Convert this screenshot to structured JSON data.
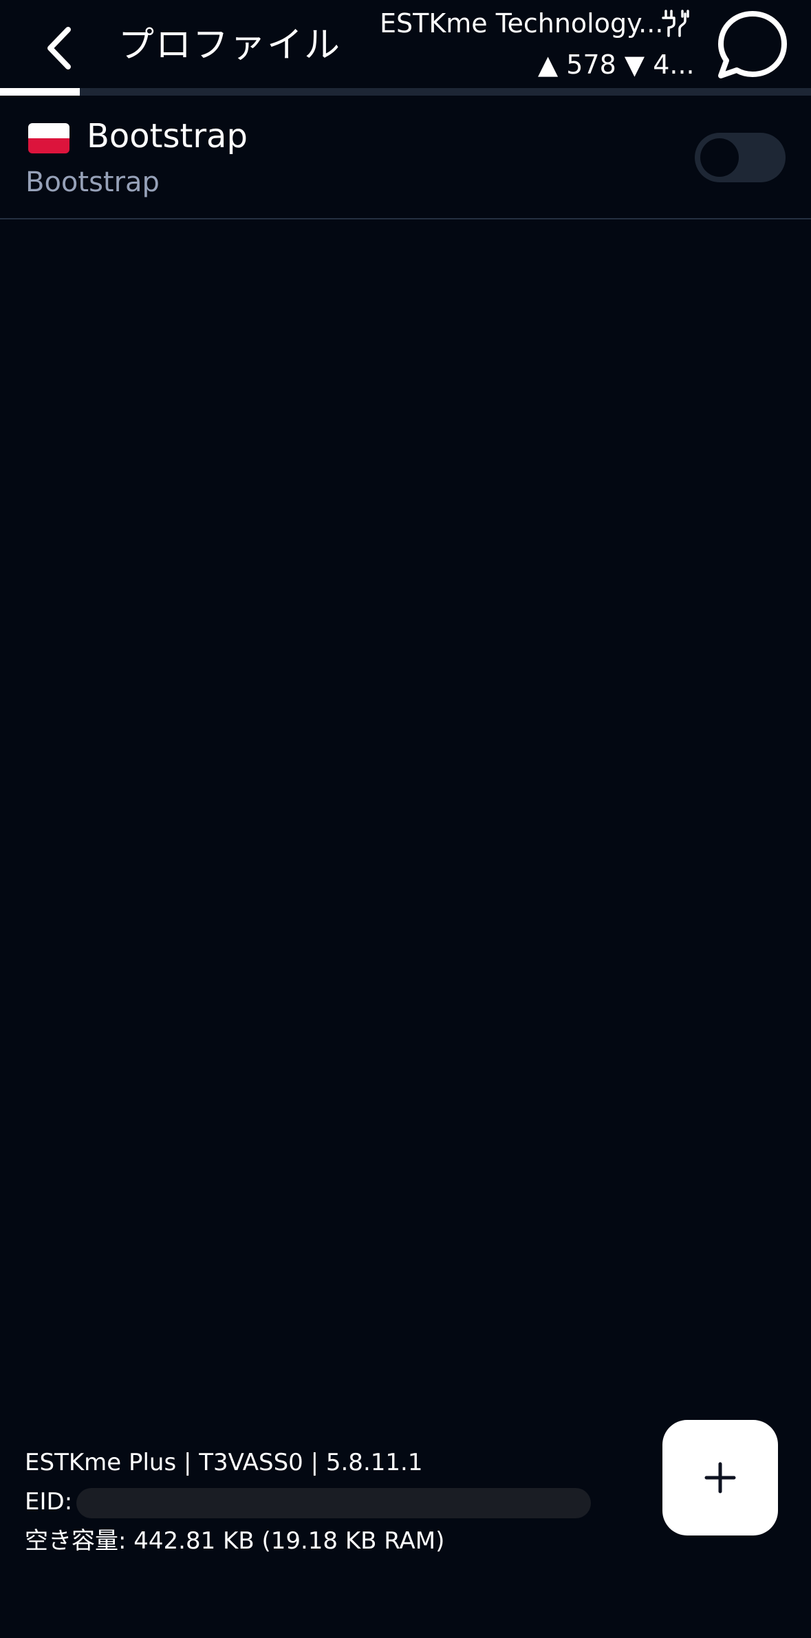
{
  "header": {
    "title": "プロファイル",
    "device_name": "ESTKme Technology...",
    "signal": "▲ 578 ▼ 4..."
  },
  "tabs": {
    "active_index": 0,
    "active_fraction": 0.098
  },
  "profile": {
    "name": "Bootstrap",
    "nickname": "Bootstrap",
    "enabled": false
  },
  "footer": {
    "device_info": "ESTKme Plus | T3VASS0 | 5.8.11.1",
    "eid_label": "EID:",
    "free_space": "空き容量: 442.81 KB (19.18 KB RAM)"
  },
  "colors": {
    "background": "#030812",
    "divider": "#253041",
    "toggle_track": "#1e2735",
    "subtext": "#96a1b8",
    "flag_white": "#ffffff",
    "flag_red": "#dc143c"
  },
  "icons": {
    "back": "chevron-left-icon",
    "usb": "usb-connection-icon",
    "chat": "chat-bubble-icon",
    "add": "plus-icon"
  }
}
